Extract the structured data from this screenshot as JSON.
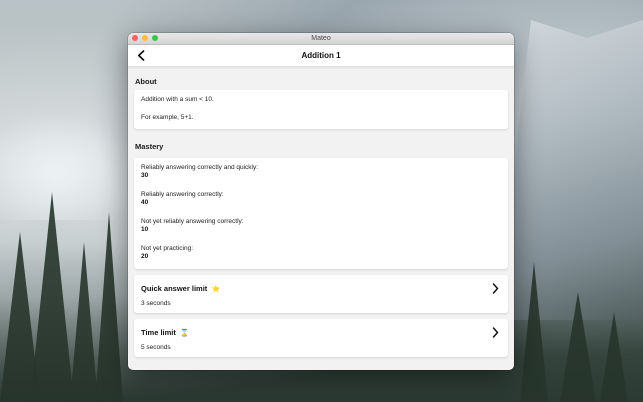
{
  "window": {
    "title": "Mateo"
  },
  "navbar": {
    "title": "Addition 1",
    "back_icon": "chevron-left-icon"
  },
  "about": {
    "header": "About",
    "line1": "Addition with a sum < 10.",
    "line2": "For example, 5+1."
  },
  "mastery": {
    "header": "Mastery",
    "items": [
      {
        "label": "Reliably answering correctly and quickly:",
        "value": "30"
      },
      {
        "label": "Reliably answering correctly:",
        "value": "40"
      },
      {
        "label": "Not yet reliably answering correctly:",
        "value": "10"
      },
      {
        "label": "Not yet practicing:",
        "value": "20"
      }
    ]
  },
  "settings": [
    {
      "title": "Quick answer limit",
      "emoji": "⭐",
      "value": "3 seconds",
      "icon": "chevron-right-icon"
    },
    {
      "title": "Time limit",
      "emoji": "⌛",
      "value": "5 seconds",
      "icon": "chevron-right-icon"
    }
  ],
  "colors": {
    "close": "#fc605c",
    "minimize": "#fdbc40",
    "zoom": "#34c84a",
    "background": "#f2f2f2",
    "card": "#ffffff"
  }
}
